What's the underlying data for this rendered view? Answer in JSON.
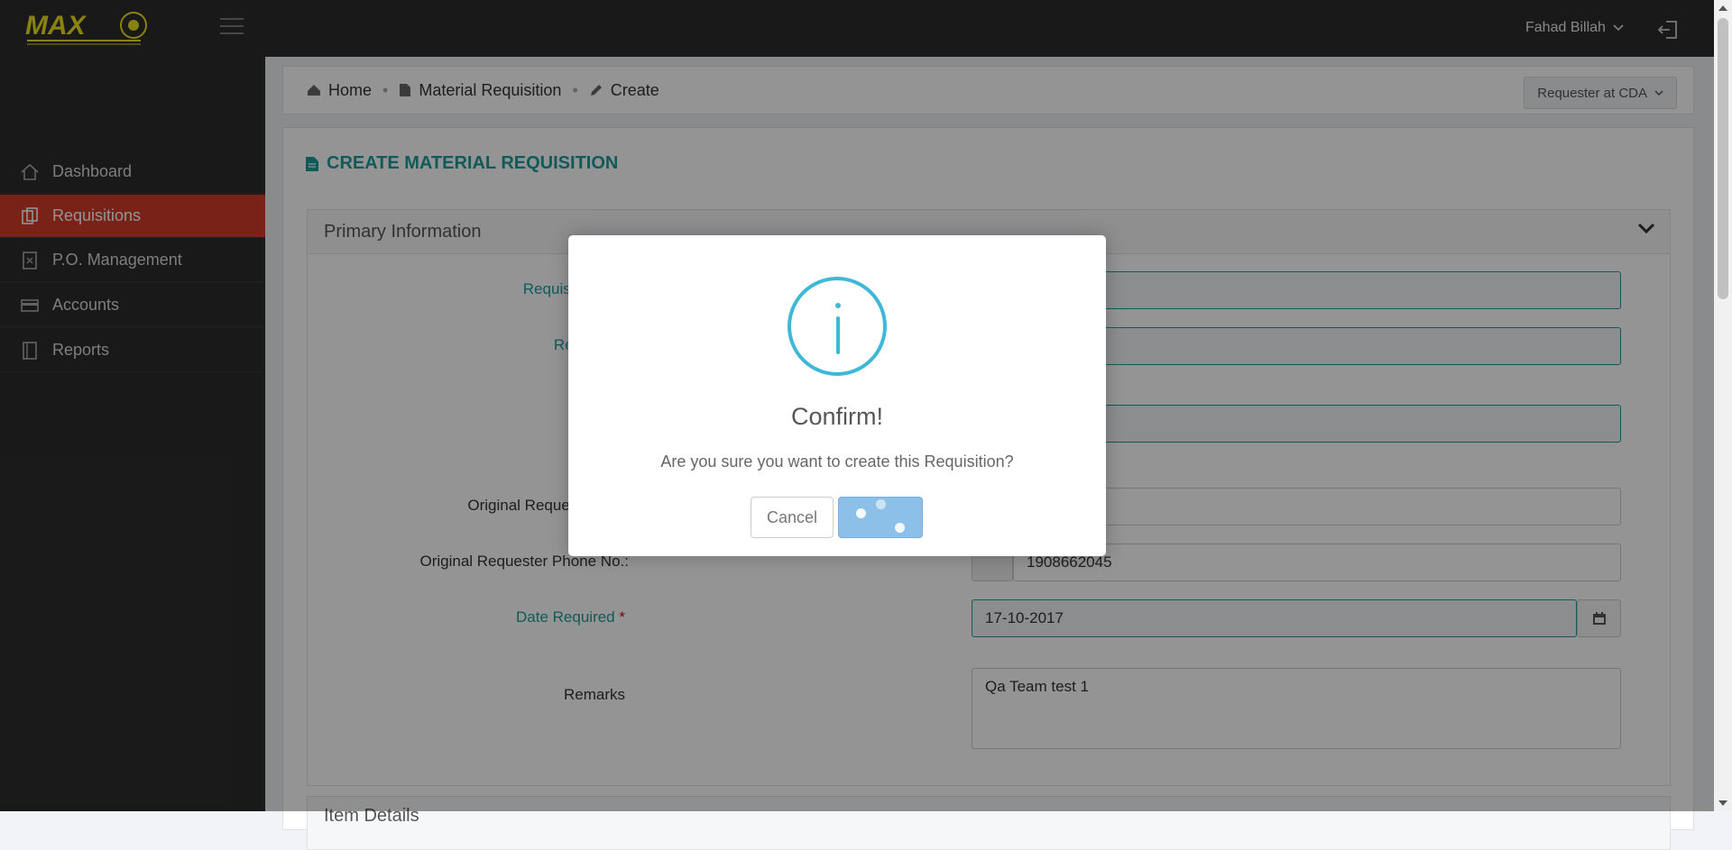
{
  "header": {
    "user_name": "Fahad Billah"
  },
  "sidebar": {
    "items": [
      {
        "label": "Dashboard",
        "icon": "home-icon"
      },
      {
        "label": "Requisitions",
        "icon": "requisition-icon",
        "active": true
      },
      {
        "label": "P.O. Management",
        "icon": "po-icon"
      },
      {
        "label": "Accounts",
        "icon": "card-icon"
      },
      {
        "label": "Reports",
        "icon": "book-icon"
      }
    ]
  },
  "breadcrumb": {
    "home": "Home",
    "section": "Material Requisition",
    "current": "Create",
    "role": "Requester at CDA"
  },
  "panel": {
    "title": "CREATE MATERIAL REQUISITION",
    "section_title": "Primary Information",
    "next_section_title": "Item Details"
  },
  "form": {
    "label_requisition": "Requisiti",
    "label_req": "Req",
    "label_r": "R",
    "label_original_requester": "Original Request",
    "label_phone": "Original Requester Phone No.:",
    "phone_value": "1908662045",
    "label_date_required": "Date Required",
    "date_required": "17-10-2017",
    "label_remarks": "Remarks",
    "remarks": "Qa Team test 1"
  },
  "modal": {
    "title": "Confirm!",
    "text": "Are you sure you want to create this Requisition?",
    "cancel_label": "Cancel"
  },
  "colors": {
    "accent_teal": "#1f9b9b",
    "active_red": "#cf3b2a",
    "info_blue": "#3fb8d8",
    "confirm_blue": "#8cc0e9"
  }
}
